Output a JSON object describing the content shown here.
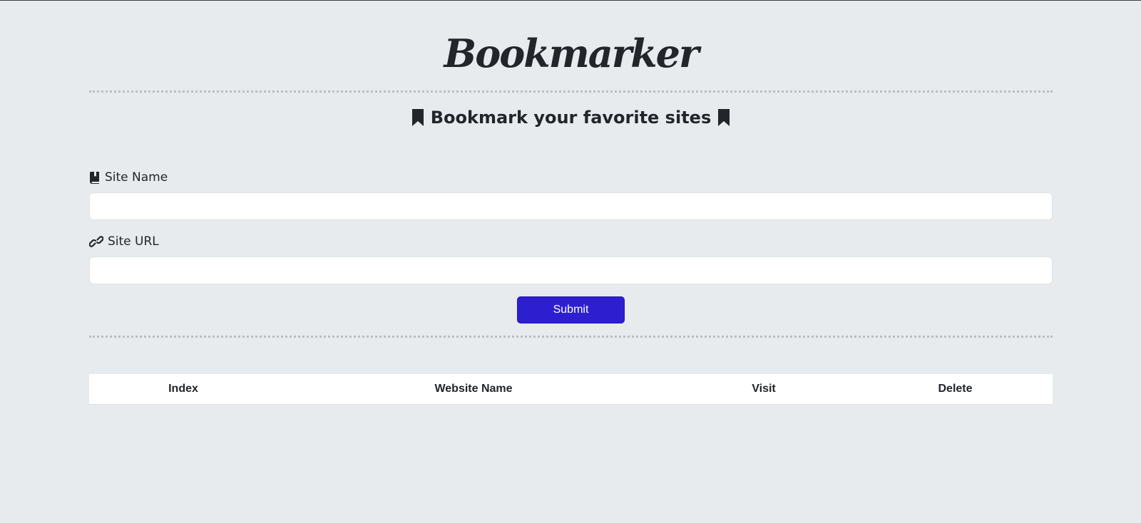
{
  "header": {
    "title": "Bookmarker",
    "subtitle": "Bookmark your favorite sites",
    "subtitle_icon": "bookmark-icon"
  },
  "form": {
    "site_name": {
      "label": "Site Name",
      "icon": "book-icon",
      "value": "",
      "placeholder": ""
    },
    "site_url": {
      "label": "Site URL",
      "icon": "link-icon",
      "value": "",
      "placeholder": ""
    },
    "submit_label": "Submit"
  },
  "table": {
    "headers": [
      "Index",
      "Website Name",
      "Visit",
      "Delete"
    ],
    "rows": []
  },
  "colors": {
    "background": "#e7ebee",
    "accent": "#2d1fcf",
    "text": "#212529"
  }
}
